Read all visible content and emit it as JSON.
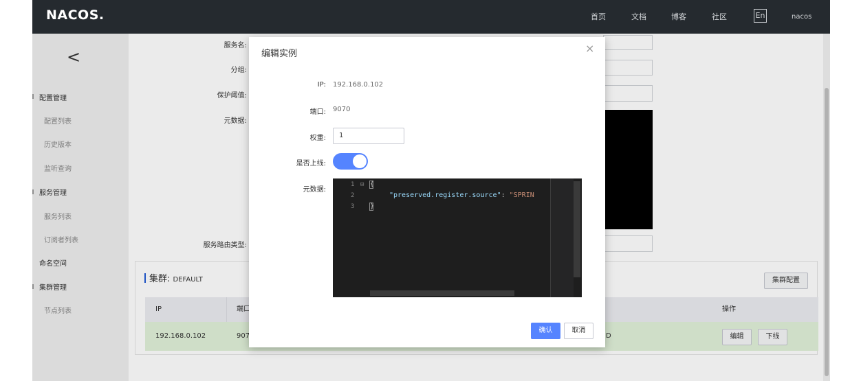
{
  "header": {
    "logo": "NACOS.",
    "nav": [
      "首页",
      "文档",
      "博客",
      "社区"
    ],
    "lang": "En",
    "user": "nacos"
  },
  "sidebar": {
    "back": "<",
    "groups": [
      {
        "label": "配置管理",
        "items": [
          "配置列表",
          "历史版本",
          "监听查询"
        ]
      },
      {
        "label": "服务管理",
        "items": [
          "服务列表",
          "订阅者列表"
        ]
      },
      {
        "label": "命名空间",
        "items": []
      },
      {
        "label": "集群管理",
        "items": [
          "节点列表"
        ]
      }
    ]
  },
  "service_form": {
    "labels": [
      "服务名:",
      "分组:",
      "保护阈值:",
      "元数据:",
      "服务路由类型:"
    ]
  },
  "cluster": {
    "title": "集群:",
    "name": "DEFAULT",
    "config_button": "集群配置",
    "columns": [
      "IP",
      "端口",
      "操作"
    ],
    "row": {
      "ip": "192.168.0.102",
      "port": "907",
      "suffix": "D"
    },
    "edit_button": "编辑",
    "offline_button": "下线"
  },
  "dialog": {
    "title": "编辑实例",
    "close": "×",
    "ip_label": "IP:",
    "ip_value": "192.168.0.102",
    "port_label": "端口:",
    "port_value": "9070",
    "weight_label": "权重:",
    "weight_value": "1",
    "online_label": "是否上线:",
    "online": true,
    "meta_label": "元数据:",
    "editor": {
      "line_numbers": [
        "1",
        "2",
        "3"
      ],
      "fold_marker": "⊟",
      "open_brace": "{",
      "close_brace": "}",
      "key": "\"preserved.register.source\"",
      "colon": ": ",
      "value": "\"SPRIN"
    },
    "confirm": "确认",
    "cancel": "取消"
  }
}
